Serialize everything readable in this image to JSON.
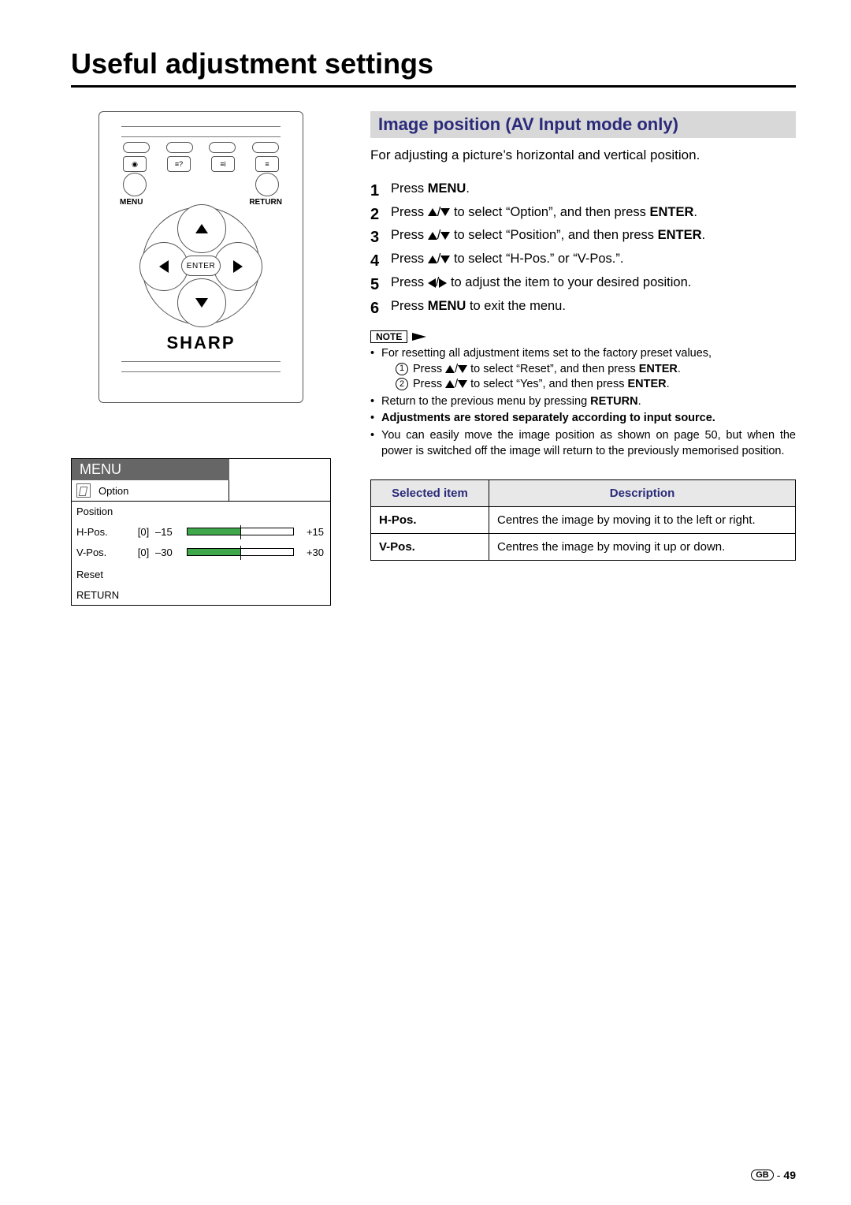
{
  "page_title": "Useful adjustment settings",
  "remote": {
    "menu_label": "MENU",
    "return_label": "RETURN",
    "enter_label": "ENTER",
    "brand": "SHARP"
  },
  "menu_screenshot": {
    "title": "MENU",
    "tab": "Option",
    "section": "Position",
    "rows": [
      {
        "label": "H-Pos.",
        "val": "[0]",
        "min": "–15",
        "max": "+15"
      },
      {
        "label": "V-Pos.",
        "val": "[0]",
        "min": "–30",
        "max": "+30"
      }
    ],
    "reset": "Reset",
    "return": "RETURN"
  },
  "section_heading": "Image position (AV Input mode only)",
  "intro": "For adjusting a picture’s horizontal and vertical position.",
  "steps": {
    "s1_a": "Press ",
    "s1_b": "MENU",
    "s1_c": ".",
    "s2_a": "Press ",
    "s2_b": " to select “Option”, and then press ",
    "s2_c": "ENTER",
    "s2_d": ".",
    "s3_a": "Press ",
    "s3_b": " to select “Position”, and then press ",
    "s3_c": "ENTER",
    "s3_d": ".",
    "s4_a": "Press ",
    "s4_b": " to select “H-Pos.” or “V-Pos.”.",
    "s5_a": "Press ",
    "s5_b": " to adjust the item to your desired position.",
    "s6_a": "Press ",
    "s6_b": "MENU",
    "s6_c": " to exit the menu."
  },
  "note_label": "NOTE",
  "notes": {
    "n1": "For resetting all adjustment items set to the factory preset values,",
    "n1s1_a": "Press ",
    "n1s1_b": " to select “Reset”, and then press ",
    "n1s1_c": "ENTER",
    "n1s1_d": ".",
    "n1s2_a": "Press ",
    "n1s2_b": " to select “Yes”, and then press ",
    "n1s2_c": "ENTER",
    "n1s2_d": ".",
    "n2_a": "Return to the previous menu by pressing ",
    "n2_b": "RETURN",
    "n2_c": ".",
    "n3": "Adjustments are stored separately according to input source.",
    "n4": "You can easily move the image position as shown on page 50, but when the power is switched off the image will return to the previously memorised position."
  },
  "table": {
    "head_item": "Selected item",
    "head_desc": "Description",
    "rows": [
      {
        "item": "H-Pos.",
        "desc": "Centres the image by moving it to the left or right."
      },
      {
        "item": "V-Pos.",
        "desc": "Centres the image by moving it up or down."
      }
    ]
  },
  "footer": {
    "region": "GB",
    "sep": "-",
    "page": "49"
  }
}
